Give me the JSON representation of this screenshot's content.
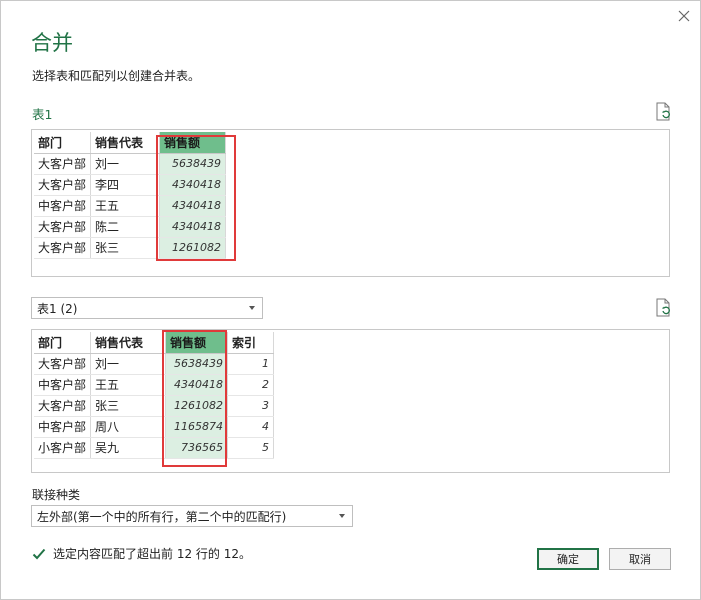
{
  "dialog": {
    "title": "合并",
    "subtitle": "选择表和匹配列以创建合并表。",
    "close_icon": "close-icon",
    "refresh_icon": "refresh-file-icon"
  },
  "table1": {
    "label": "表1",
    "columns": [
      "部门",
      "销售代表",
      "销售额"
    ],
    "selected_column": 2,
    "rows": [
      [
        "大客户部",
        "刘一",
        "5638439"
      ],
      [
        "大客户部",
        "李四",
        "4340418"
      ],
      [
        "中客户部",
        "王五",
        "4340418"
      ],
      [
        "大客户部",
        "陈二",
        "4340418"
      ],
      [
        "大客户部",
        "张三",
        "1261082"
      ]
    ]
  },
  "table2": {
    "select_value": "表1 (2)",
    "columns": [
      "部门",
      "销售代表",
      "销售额",
      "索引"
    ],
    "selected_column": 2,
    "rows": [
      [
        "大客户部",
        "刘一",
        "5638439",
        "1"
      ],
      [
        "中客户部",
        "王五",
        "4340418",
        "2"
      ],
      [
        "大客户部",
        "张三",
        "1261082",
        "3"
      ],
      [
        "中客户部",
        "周八",
        "1165874",
        "4"
      ],
      [
        "小客户部",
        "吴九",
        "736565",
        "5"
      ]
    ]
  },
  "join": {
    "label": "联接种类",
    "value": "左外部(第一个中的所有行，第二个中的匹配行)"
  },
  "status": {
    "text": "选定内容匹配了超出前 12 行的 12。",
    "icon": "check-icon"
  },
  "buttons": {
    "ok": "确定",
    "cancel": "取消"
  },
  "colors": {
    "accent": "#217346",
    "selected_header": "#6fbe8c",
    "selected_cell": "#dcefe2",
    "highlight_box": "#e03a3a"
  }
}
